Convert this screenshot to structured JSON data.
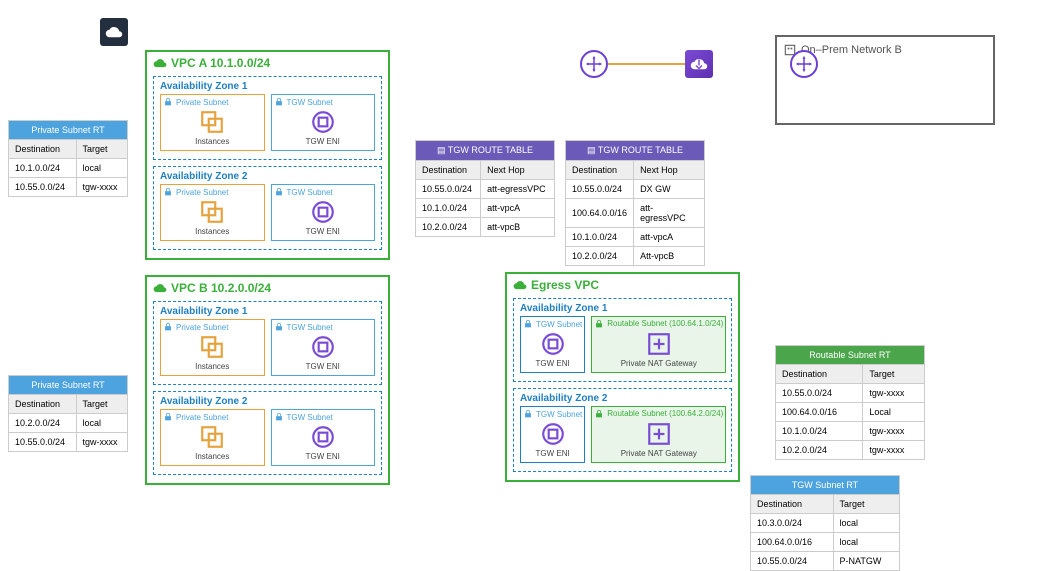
{
  "cloud_label": "AWS Cloud",
  "vpcA": {
    "title": "VPC A 10.1.0.0/24",
    "az1": {
      "title": "Availability Zone 1",
      "priv": "Private Subnet",
      "tgw": "TGW Subnet",
      "c1": "Instances",
      "c2": "TGW ENI"
    },
    "az2": {
      "title": "Availability Zone 2",
      "priv": "Private Subnet",
      "tgw": "TGW Subnet",
      "c1": "Instances",
      "c2": "TGW ENI"
    }
  },
  "vpcB": {
    "title": "VPC B 10.2.0.0/24",
    "az1": {
      "title": "Availability Zone 1",
      "priv": "Private Subnet",
      "tgw": "TGW Subnet",
      "c1": "Instances",
      "c2": "TGW ENI"
    },
    "az2": {
      "title": "Availability Zone 2",
      "priv": "Private Subnet",
      "tgw": "TGW Subnet",
      "c1": "Instances",
      "c2": "TGW ENI"
    }
  },
  "egress": {
    "title": "Egress VPC",
    "az1": {
      "title": "Availability Zone 1",
      "tgw": "TGW Subnet",
      "rsub": "Routable Subnet\n(100.64.1.0/24)",
      "c1": "TGW ENI",
      "c2": "Private NAT Gateway"
    },
    "az2": {
      "title": "Availability Zone 2",
      "tgw": "TGW Subnet",
      "rsub": "Routable Subnet\n(100.64.2.0/24)",
      "c1": "TGW ENI",
      "c2": "Private NAT Gateway"
    }
  },
  "onprem_title": "On–Prem Network B",
  "rtA": {
    "title": "Private Subnet RT",
    "h1": "Destination",
    "h2": "Target",
    "rows": [
      [
        "10.1.0.0/24",
        "local"
      ],
      [
        "10.55.0.0/24",
        "tgw-xxxx"
      ]
    ]
  },
  "rtB": {
    "title": "Private Subnet RT",
    "h1": "Destination",
    "h2": "Target",
    "rows": [
      [
        "10.2.0.0/24",
        "local"
      ],
      [
        "10.55.0.0/24",
        "tgw-xxxx"
      ]
    ]
  },
  "tgwRT1": {
    "title": "TGW ROUTE TABLE",
    "h1": "Destination",
    "h2": "Next Hop",
    "rows": [
      [
        "10.55.0.0/24",
        "att-egressVPC"
      ],
      [
        "10.1.0.0/24",
        "att-vpcA"
      ],
      [
        "10.2.0.0/24",
        "att-vpcB"
      ]
    ]
  },
  "tgwRT2": {
    "title": "TGW ROUTE TABLE",
    "h1": "Destination",
    "h2": "Next Hop",
    "rows": [
      [
        "10.55.0.0/24",
        "DX GW"
      ],
      [
        "100.64.0.0/16",
        "att-egressVPC"
      ],
      [
        "10.1.0.0/24",
        "att-vpcA"
      ],
      [
        "10.2.0.0/24",
        "Att-vpcB"
      ]
    ]
  },
  "routableRT": {
    "title": "Routable Subnet RT",
    "h1": "Destination",
    "h2": "Target",
    "rows": [
      [
        "10.55.0.0/24",
        "tgw-xxxx"
      ],
      [
        "100.64.0.0/16",
        "Local"
      ],
      [
        "10.1.0.0/24",
        "tgw-xxxx"
      ],
      [
        "10.2.0.0/24",
        "tgw-xxxx"
      ]
    ]
  },
  "tgwSubRT": {
    "title": "TGW Subnet RT",
    "h1": "Destination",
    "h2": "Target",
    "rows": [
      [
        "10.3.0.0/24",
        "local"
      ],
      [
        "100.64.0.0/16",
        "local"
      ],
      [
        "10.55.0.0/24",
        "P-NATGW"
      ]
    ]
  }
}
